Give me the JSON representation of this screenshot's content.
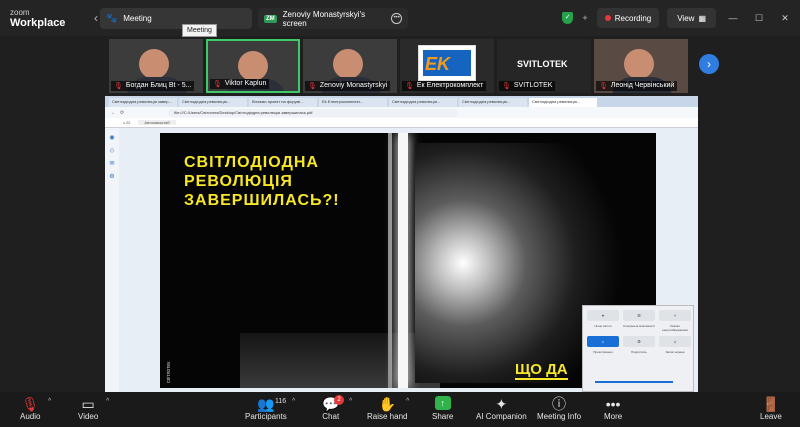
{
  "app": {
    "brand_top": "zoom",
    "brand_bottom": "Workplace"
  },
  "nav": {
    "back": "‹",
    "forward": "›"
  },
  "tabs": {
    "meeting_label": "Meeting",
    "share_badge": "ZM",
    "share_label": "Zenoviy Monastyrskyi's screen",
    "tooltip": "Meeting"
  },
  "status": {
    "recording": "Recording",
    "view": "View"
  },
  "colors": {
    "accent": "#2f9a57",
    "record": "#e5383b",
    "slide_text": "#f7e629"
  },
  "participants": [
    {
      "name": "Богдан Блиц Bt - 5...",
      "muted": true
    },
    {
      "name": "Viktor Kaplun",
      "muted": true,
      "active": true
    },
    {
      "name": "Zenoviy Monastyrskyi",
      "muted": true
    },
    {
      "name": "Ек Електрокомплект",
      "muted": true,
      "logo": "EK"
    },
    {
      "name": "SVITLOTEK",
      "muted": true,
      "card_text": "SVITLOTEK"
    },
    {
      "name": "Леонід Червінський",
      "muted": true
    }
  ],
  "browser": {
    "tabs": [
      "Світлодіодна революція завер...",
      "Світлодіодна революція...",
      "Вітаємо проект на форумі...",
      "Ek Електрокомплект...",
      "Світлодіодна революція...",
      "Світлодіодна революція...",
      "Світлодіодна революція..."
    ],
    "url": "file:///C:/Users/Світлотек/Desktop/Світлодіодна революція завершилась.pdf",
    "page_indicator": "з 22",
    "zoom_label": "Автомасштаб"
  },
  "slide": {
    "heading": "СВІТЛОДІОДНА\nРЕВОЛЮЦІЯ\nЗАВЕРШИЛАСЬ?!",
    "brand_vertical": "світлотек",
    "bottom_text": "ЩО ДА"
  },
  "quick_settings": {
    "buttons": [
      "⌖",
      "☰",
      "✧",
      "☼",
      "⚙",
      "♫"
    ],
    "labels": [
      "Нічне світло",
      "Спеціальні можливості",
      "Режим енергозбереження",
      "Проєктування",
      "Поділитись",
      "Запис екрана"
    ]
  },
  "toolbar": {
    "audio": "Audio",
    "video": "Video",
    "participants": "Participants",
    "participant_count": "116",
    "chat": "Chat",
    "chat_badge": "2",
    "raise_hand": "Raise hand",
    "share": "Share",
    "ai_companion": "AI Companion",
    "meeting_info": "Meeting Info",
    "more": "More",
    "leave": "Leave"
  }
}
